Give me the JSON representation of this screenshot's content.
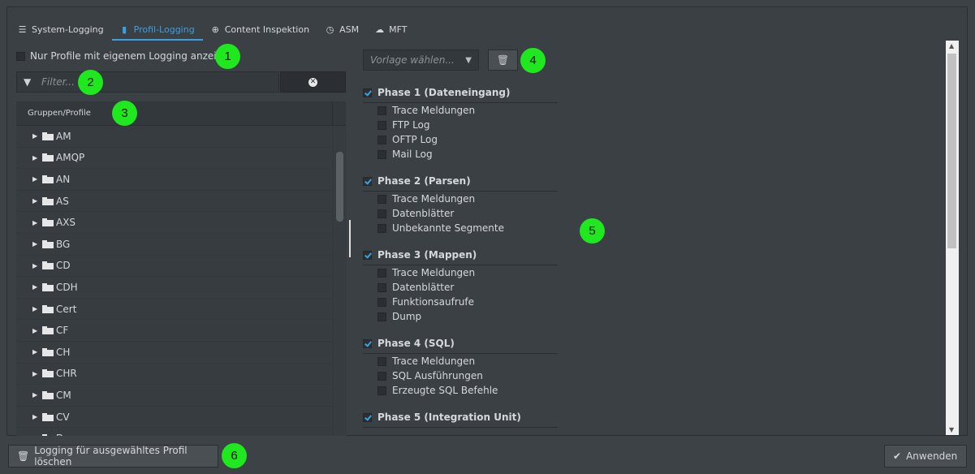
{
  "tabs": [
    {
      "label": "System-Logging",
      "icon": "list-icon",
      "active": false
    },
    {
      "label": "Profil-Logging",
      "icon": "database-icon",
      "active": true
    },
    {
      "label": "Content Inspektion",
      "icon": "search-plus-icon",
      "active": false
    },
    {
      "label": "ASM",
      "icon": "clock-icon",
      "active": false
    },
    {
      "label": "MFT",
      "icon": "cloud-upload-icon",
      "active": false
    }
  ],
  "left": {
    "only_own_logging_label": "Nur Profile mit eigenem Logging anzeigen",
    "filter_placeholder": "Filter...",
    "tree_header": "Gruppen/Profile",
    "groups": [
      "AM",
      "AMQP",
      "AN",
      "AS",
      "AXS",
      "BG",
      "CD",
      "CDH",
      "Cert",
      "CF",
      "CH",
      "CHR",
      "CM",
      "CV",
      "Demo"
    ]
  },
  "right": {
    "template_placeholder": "Vorlage wählen...",
    "phases": [
      {
        "title": "Phase 1 (Dateneingang)",
        "checked": true,
        "items": [
          "Trace Meldungen",
          "FTP Log",
          "OFTP Log",
          "Mail Log"
        ]
      },
      {
        "title": "Phase 2 (Parsen)",
        "checked": true,
        "items": [
          "Trace Meldungen",
          "Datenblätter",
          "Unbekannte Segmente"
        ]
      },
      {
        "title": "Phase 3 (Mappen)",
        "checked": true,
        "items": [
          "Trace Meldungen",
          "Datenblätter",
          "Funktionsaufrufe",
          "Dump"
        ]
      },
      {
        "title": "Phase 4 (SQL)",
        "checked": true,
        "items": [
          "Trace Meldungen",
          "SQL Ausführungen",
          "Erzeugte SQL Befehle"
        ]
      },
      {
        "title": "Phase 5 (Integration Unit)",
        "checked": true,
        "items": []
      }
    ]
  },
  "footer": {
    "delete_label": "Logging für ausgewähltes Profil löschen",
    "apply_label": "Anwenden"
  },
  "badges": [
    "1",
    "2",
    "3",
    "4",
    "5",
    "6"
  ],
  "colors": {
    "accent": "#3aa0e0",
    "badge": "#1fe81f",
    "background": "#3d4247"
  }
}
